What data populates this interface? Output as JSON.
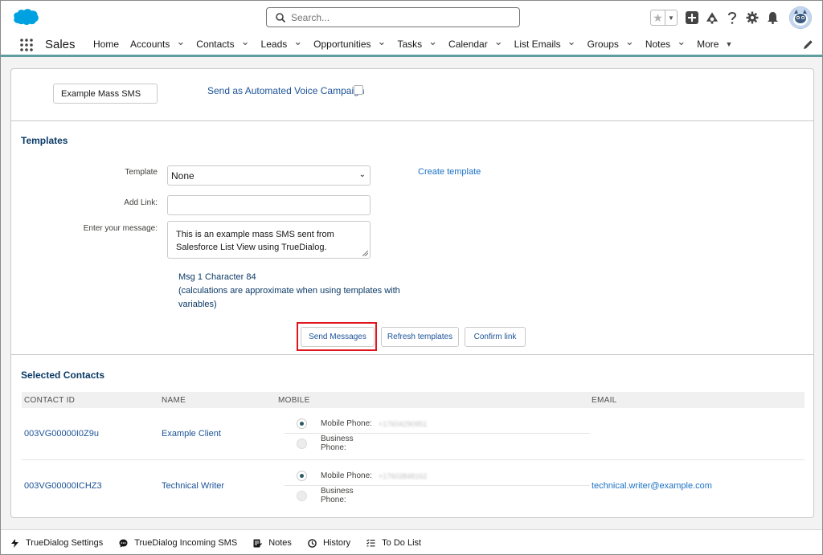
{
  "header": {
    "search_placeholder": "Search...",
    "brand_color": "#00a1e0"
  },
  "nav": {
    "app_name": "Sales",
    "items": [
      {
        "label": "Home",
        "has_menu": false
      },
      {
        "label": "Accounts",
        "has_menu": true
      },
      {
        "label": "Contacts",
        "has_menu": true
      },
      {
        "label": "Leads",
        "has_menu": true
      },
      {
        "label": "Opportunities",
        "has_menu": true
      },
      {
        "label": "Tasks",
        "has_menu": true
      },
      {
        "label": "Calendar",
        "has_menu": true
      },
      {
        "label": "List Emails",
        "has_menu": true
      },
      {
        "label": "Groups",
        "has_menu": true
      },
      {
        "label": "Notes",
        "has_menu": true
      },
      {
        "label": "More",
        "has_menu": true
      }
    ]
  },
  "campaign": {
    "name_value": "Example Mass SMS",
    "voice_label": "Send as Automated Voice Campaign",
    "voice_checked": false
  },
  "templates": {
    "title": "Templates",
    "template_label": "Template",
    "template_value": "None",
    "add_link_label": "Add Link:",
    "add_link_value": "",
    "message_label": "Enter your message:",
    "message_value": "This is an example mass SMS sent from Salesforce List View using TrueDialog.",
    "create_template": "Create template",
    "msg_count": "Msg 1 Character 84",
    "msg_note": "(calculations are approximate when using templates with variables)",
    "buttons": {
      "send": "Send Messages",
      "refresh": "Refresh templates",
      "confirm": "Confirm link"
    }
  },
  "contacts": {
    "title": "Selected Contacts",
    "columns": [
      "CONTACT ID",
      "NAME",
      "MOBILE",
      "EMAIL"
    ],
    "rows": [
      {
        "id": "003VG00000I0Z9u",
        "name": "Example Client",
        "mobile_label": "Mobile Phone:",
        "mobile_value": "+17604290951",
        "business_label": "Business Phone:",
        "email": ""
      },
      {
        "id": "003VG00000ICHZ3",
        "name": "Technical Writer",
        "mobile_label": "Mobile Phone:",
        "mobile_value": "+17603848162",
        "business_label": "Business Phone:",
        "email": "technical.writer@example.com"
      }
    ]
  },
  "utility": {
    "items": [
      {
        "label": "TrueDialog Settings",
        "icon": "lightning-icon"
      },
      {
        "label": "TrueDialog Incoming SMS",
        "icon": "chat-icon"
      },
      {
        "label": "Notes",
        "icon": "notes-icon"
      },
      {
        "label": "History",
        "icon": "clock-icon"
      },
      {
        "label": "To Do List",
        "icon": "checklist-icon"
      }
    ]
  }
}
